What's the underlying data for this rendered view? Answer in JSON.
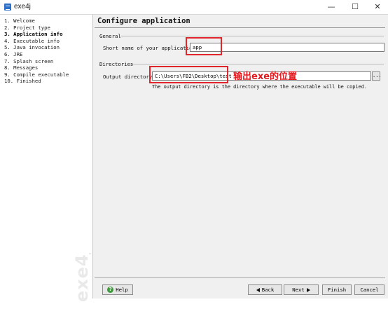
{
  "window": {
    "title": "exe4j",
    "minimize_glyph": "—",
    "maximize_glyph": "☐",
    "close_glyph": "✕"
  },
  "sidebar": {
    "steps": [
      {
        "label": "1. Welcome",
        "active": false
      },
      {
        "label": "2. Project type",
        "active": false
      },
      {
        "label": "3. Application info",
        "active": true
      },
      {
        "label": "4. Executable info",
        "active": false
      },
      {
        "label": "5. Java invocation",
        "active": false
      },
      {
        "label": "6. JRE",
        "active": false
      },
      {
        "label": "7. Splash screen",
        "active": false
      },
      {
        "label": "8. Messages",
        "active": false
      },
      {
        "label": "9. Compile executable",
        "active": false
      },
      {
        "label": "10. Finished",
        "active": false
      }
    ],
    "watermark": "exe4j"
  },
  "main": {
    "heading": "Configure application",
    "general": {
      "section_title": "General",
      "short_name_label": "Short name of your application:",
      "short_name_value": "app"
    },
    "directories": {
      "section_title": "Directories",
      "output_label": "Output directory:",
      "output_value": "C:\\Users\\FB2\\Desktop\\test",
      "browse_label": "...",
      "hint": "The output directory is the directory where the executable will be copied."
    },
    "annotation": "输出exe的位置"
  },
  "buttons": {
    "help": "Help",
    "back": "Back",
    "next": "Next",
    "finish": "Finish",
    "cancel": "Cancel"
  },
  "colors": {
    "annotation_red": "#e3191f",
    "help_icon_green": "#3b9b3b",
    "app_icon_blue": "#2b6fc9"
  }
}
